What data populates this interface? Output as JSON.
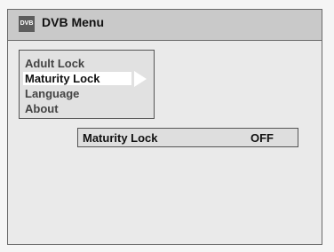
{
  "window": {
    "title": "DVB Menu",
    "logo_text": "DVB"
  },
  "menu": {
    "items": [
      {
        "label": "Adult Lock"
      },
      {
        "label": "Maturity Lock"
      },
      {
        "label": "Language"
      },
      {
        "label": "About"
      }
    ],
    "selected_index": 1
  },
  "setting": {
    "label": "Maturity Lock",
    "value": "OFF"
  },
  "colors": {
    "background": "#eaeaea",
    "titlebar": "#c9c9c9",
    "menu_bg": "#e1e1e1",
    "selected_bg": "#ffffff"
  },
  "icons": {
    "logo": "dvb-logo-icon",
    "arrow": "right-arrow-icon"
  }
}
